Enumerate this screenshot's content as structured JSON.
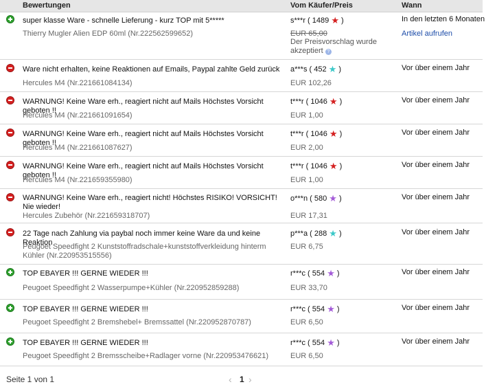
{
  "header": {
    "col_feedback": "Bewertungen",
    "col_buyer": "Vom Käufer/Preis",
    "col_when": "Wann"
  },
  "colors": {
    "positive": "#2ea12e",
    "negative": "#d62020",
    "star_red": "#d42020",
    "star_turquoise": "#3cc8c8",
    "star_purple": "#a45cd8",
    "link": "#1b4ba8"
  },
  "rows": [
    {
      "type": "positive",
      "icon": "plus-circle-icon",
      "comment": "super klasse Ware - schnelle Lieferung - kurz TOP mit 5*****",
      "item": "Thierry Mugler Alien EDP 60ml (Nr.222562599652)",
      "buyer": "s***r ( 1489",
      "star": "red-star-icon",
      "star_color": "#d42020",
      "price": "EUR 65,00",
      "note": "Der Preisvorschlag wurde akzeptiert",
      "when": "In den letzten 6 Monaten",
      "link": "Artikel aufrufen"
    },
    {
      "type": "negative",
      "icon": "minus-circle-icon",
      "comment": "Ware nicht erhalten, keine Reaktionen auf Emails, Paypal zahlte Geld zurück",
      "item": "Hercules M4 (Nr.221661084134)",
      "buyer": "a***s ( 452",
      "star": "turquoise-star-icon",
      "star_color": "#3cc8c8",
      "price": "EUR 102,26",
      "when": "Vor über einem Jahr"
    },
    {
      "type": "negative",
      "icon": "minus-circle-icon",
      "comment": "WARNUNG! Keine Ware erh., reagiert nicht auf Mails Höchstes Vorsicht geboten !!",
      "item": "Hercules M4 (Nr.221661091654)",
      "buyer": "t***r ( 1046",
      "star": "red-star-icon",
      "star_color": "#d42020",
      "price": "EUR 1,00",
      "when": "Vor über einem Jahr"
    },
    {
      "type": "negative",
      "icon": "minus-circle-icon",
      "comment": "WARNUNG! Keine Ware erh., reagiert nicht auf Mails Höchstes Vorsicht geboten !!",
      "item": "Hercules M4 (Nr.221661087627)",
      "buyer": "t***r ( 1046",
      "star": "red-star-icon",
      "star_color": "#d42020",
      "price": "EUR 2,00",
      "when": "Vor über einem Jahr"
    },
    {
      "type": "negative",
      "icon": "minus-circle-icon",
      "comment": "WARNUNG! Keine Ware erh., reagiert nicht auf Mails Höchstes Vorsicht geboten !!",
      "item": "Hercules M4 (Nr.221659355980)",
      "buyer": "t***r ( 1046",
      "star": "red-star-icon",
      "star_color": "#d42020",
      "price": "EUR 1,00",
      "when": "Vor über einem Jahr"
    },
    {
      "type": "negative",
      "icon": "minus-circle-icon",
      "comment": "WARNUNG! Keine Ware erh., reagiert nicht! Höchstes RISIKO! VORSICHT! Nie wieder!",
      "item": "Hercules Zubehör (Nr.221659318707)",
      "buyer": "o***n ( 580",
      "star": "purple-star-icon",
      "star_color": "#a45cd8",
      "price": "EUR 17,31",
      "when": "Vor über einem Jahr"
    },
    {
      "type": "negative",
      "icon": "minus-circle-icon",
      "comment": "22 Tage nach Zahlung via paybal noch immer keine Ware da und keine Reaktion",
      "item": "Peugoet Speedfight 2 Kunststoffradschale+kunststoffverkleidung hinterm Kühler (Nr.220953515556)",
      "buyer": "p***a ( 288",
      "star": "turquoise-star-icon",
      "star_color": "#3cc8c8",
      "price": "EUR 6,75",
      "when": "Vor über einem Jahr"
    },
    {
      "type": "positive",
      "icon": "plus-circle-icon",
      "comment": "TOP EBAYER !!! GERNE WIEDER !!!",
      "item": "Peugoet Speedfight 2 Wasserpumpe+Kühler (Nr.220952859288)",
      "buyer": "r***c ( 554",
      "star": "purple-star-icon",
      "star_color": "#a45cd8",
      "price": "EUR 33,70",
      "when": "Vor über einem Jahr"
    },
    {
      "type": "positive",
      "icon": "plus-circle-icon",
      "comment": "TOP EBAYER !!! GERNE WIEDER !!!",
      "item": "Peugoet Speedfight 2 Bremshebel+ Bremssattel (Nr.220952870787)",
      "buyer": "r***c ( 554",
      "star": "purple-star-icon",
      "star_color": "#a45cd8",
      "price": "EUR 6,50",
      "when": "Vor über einem Jahr"
    },
    {
      "type": "positive",
      "icon": "plus-circle-icon",
      "comment": "TOP EBAYER !!! GERNE WIEDER !!!",
      "item": "Peugoet Speedfight 2 Bremsscheibe+Radlager vorne (Nr.220953476621)",
      "buyer": "r***c ( 554",
      "star": "purple-star-icon",
      "star_color": "#a45cd8",
      "price": "EUR 6,50",
      "when": "Vor über einem Jahr"
    }
  ],
  "pagination": {
    "info": "Seite 1 von 1",
    "current": "1",
    "prev_icon": "chevron-left-icon",
    "next_icon": "chevron-right-icon"
  }
}
